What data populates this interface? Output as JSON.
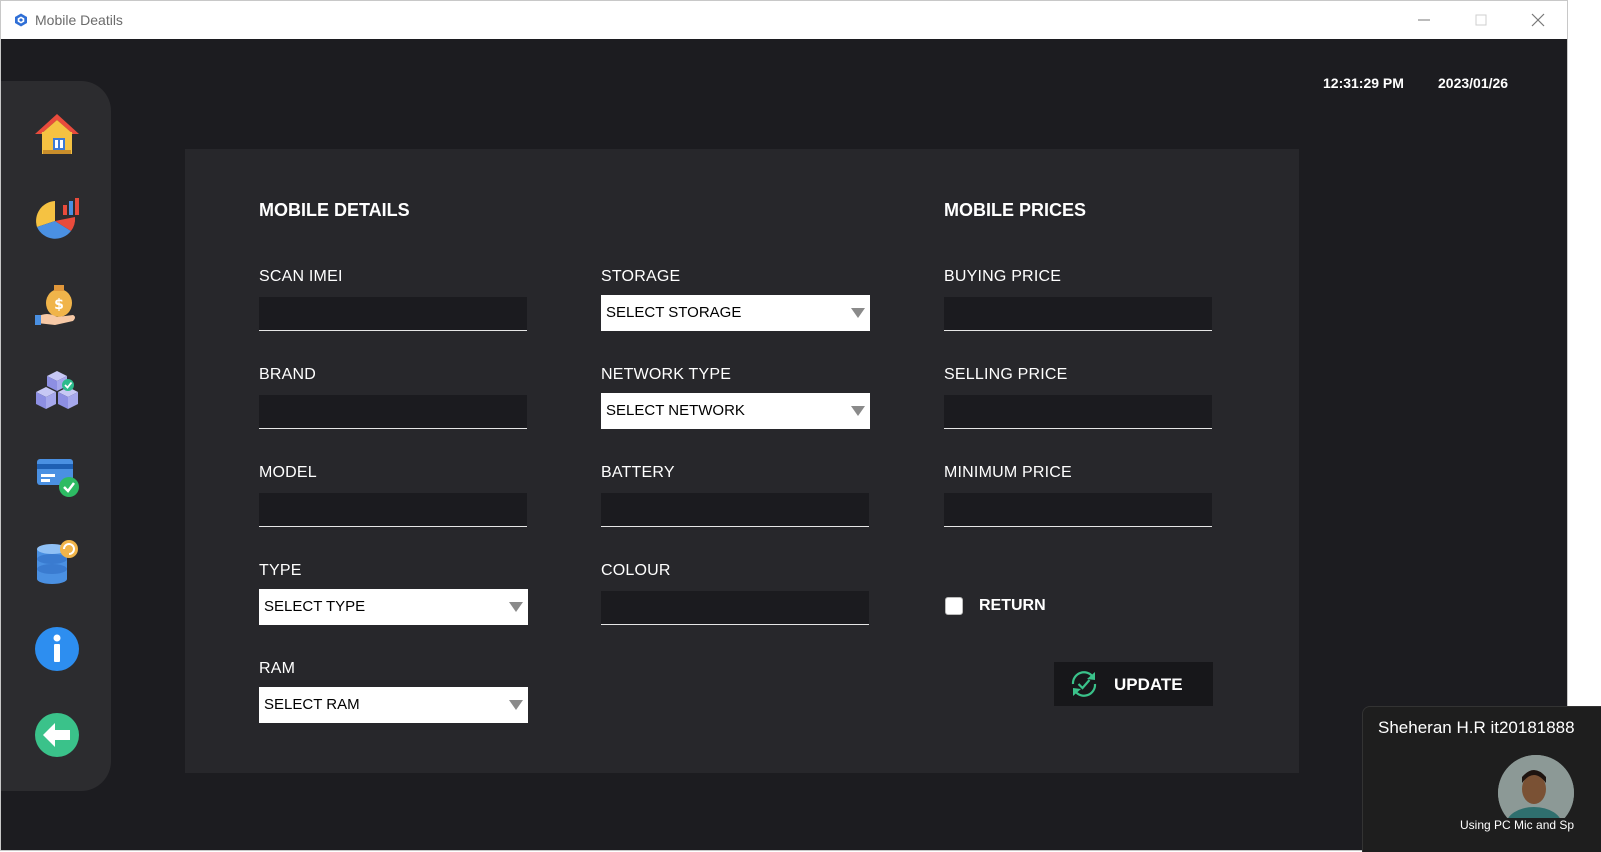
{
  "window": {
    "title": "Mobile Deatils"
  },
  "header": {
    "time": "12:31:29 PM",
    "date": "2023/01/26"
  },
  "sidebar": {
    "items": [
      {
        "name": "home",
        "icon": "house-icon"
      },
      {
        "name": "reports",
        "icon": "pie-chart-icon"
      },
      {
        "name": "sales",
        "icon": "money-bag-icon"
      },
      {
        "name": "inventory",
        "icon": "stock-boxes-icon"
      },
      {
        "name": "payments",
        "icon": "card-check-icon"
      },
      {
        "name": "database",
        "icon": "database-refresh-icon"
      },
      {
        "name": "info",
        "icon": "info-icon"
      },
      {
        "name": "back",
        "icon": "arrow-left-icon"
      }
    ]
  },
  "form": {
    "details_heading": "MOBILE DETAILS",
    "prices_heading": "MOBILE PRICES",
    "scan_imei": {
      "label": "SCAN IMEI",
      "value": ""
    },
    "brand": {
      "label": "BRAND",
      "value": ""
    },
    "model": {
      "label": "MODEL",
      "value": ""
    },
    "type": {
      "label": "TYPE",
      "selected": "SELECT TYPE"
    },
    "ram": {
      "label": "RAM",
      "selected": "SELECT RAM"
    },
    "storage": {
      "label": "STORAGE",
      "selected": "SELECT STORAGE"
    },
    "network": {
      "label": "NETWORK TYPE",
      "selected": "SELECT NETWORK"
    },
    "battery": {
      "label": "BATTERY",
      "value": ""
    },
    "colour": {
      "label": "COLOUR",
      "value": ""
    },
    "buying_price": {
      "label": "BUYING PRICE",
      "value": ""
    },
    "selling_price": {
      "label": "SELLING PRICE",
      "value": ""
    },
    "minimum_price": {
      "label": "MINIMUM PRICE",
      "value": ""
    },
    "return": {
      "label": "RETURN",
      "checked": false
    },
    "update_label": "UPDATE"
  },
  "video_overlay": {
    "name": "Sheheran H.R it20181888",
    "status": "Using PC Mic and Sp"
  },
  "colors": {
    "background": "#1c1c20",
    "panel": "#27272b",
    "sidebar": "#2c2c2f",
    "accent_green": "#3ac28a"
  }
}
